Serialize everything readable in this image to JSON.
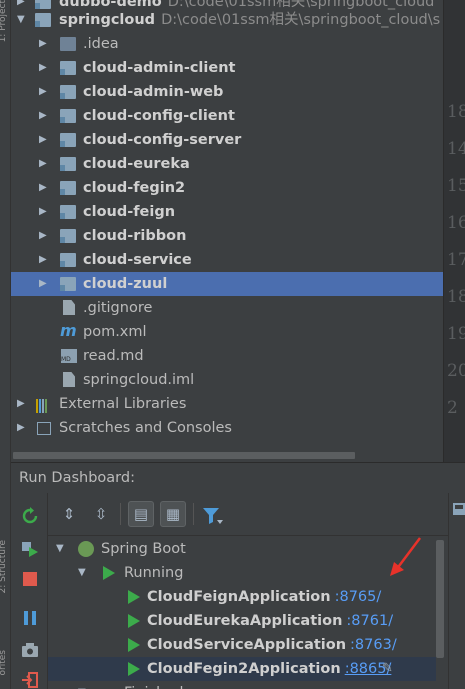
{
  "left_strip": {
    "top_text": "1: Project",
    "bottom_text": "2: Structure",
    "bottom_text2": "orites"
  },
  "tree": {
    "partial_row": {
      "label": "dubbo-demo",
      "path": "D:\\code\\01ssm相关\\springboot_cloud"
    },
    "root": {
      "label": "springcloud",
      "path": "D:\\code\\01ssm相关\\springboot_cloud\\s"
    },
    "items": [
      {
        "label": ".idea",
        "bold": false,
        "kind": "plain-folder"
      },
      {
        "label": "cloud-admin-client",
        "bold": true,
        "kind": "module"
      },
      {
        "label": "cloud-admin-web",
        "bold": true,
        "kind": "module"
      },
      {
        "label": "cloud-config-client",
        "bold": true,
        "kind": "module"
      },
      {
        "label": "cloud-config-server",
        "bold": true,
        "kind": "module"
      },
      {
        "label": "cloud-eureka",
        "bold": true,
        "kind": "module"
      },
      {
        "label": "cloud-fegin2",
        "bold": true,
        "kind": "module"
      },
      {
        "label": "cloud-feign",
        "bold": true,
        "kind": "module"
      },
      {
        "label": "cloud-ribbon",
        "bold": true,
        "kind": "module"
      },
      {
        "label": "cloud-service",
        "bold": true,
        "kind": "module"
      },
      {
        "label": "cloud-zuul",
        "bold": true,
        "kind": "module",
        "selected": true
      }
    ],
    "files": [
      {
        "label": ".gitignore",
        "icon": "file-icon"
      },
      {
        "label": "pom.xml",
        "icon": "maven-icon"
      },
      {
        "label": "read.md",
        "icon": "markdown-icon"
      },
      {
        "label": "springcloud.iml",
        "icon": "iml-icon"
      }
    ],
    "external_libraries": "External Libraries",
    "scratches": "Scratches and Consoles"
  },
  "gutter": {
    "line_numbers": [
      "18",
      "14",
      "15",
      "16",
      "17",
      "18",
      "19",
      "20",
      "2"
    ]
  },
  "dashboard": {
    "title": "Run Dashboard:",
    "spring_boot": "Spring Boot",
    "running": "Running",
    "apps": [
      {
        "name": "CloudFeignApplication",
        "port": ":8765/"
      },
      {
        "name": "CloudEurekaApplication",
        "port": ":8761/"
      },
      {
        "name": "CloudServiceApplication",
        "port": ":8763/"
      },
      {
        "name": "CloudFegin2Application",
        "port": ":8865/",
        "selected": true
      }
    ],
    "finished_partial": "Finished"
  },
  "colors": {
    "background": "#3c3f41",
    "selection": "#4b6eaf",
    "run_green": "#3cab4b",
    "link_blue": "#589df6",
    "annotation_red": "#e8322a"
  }
}
